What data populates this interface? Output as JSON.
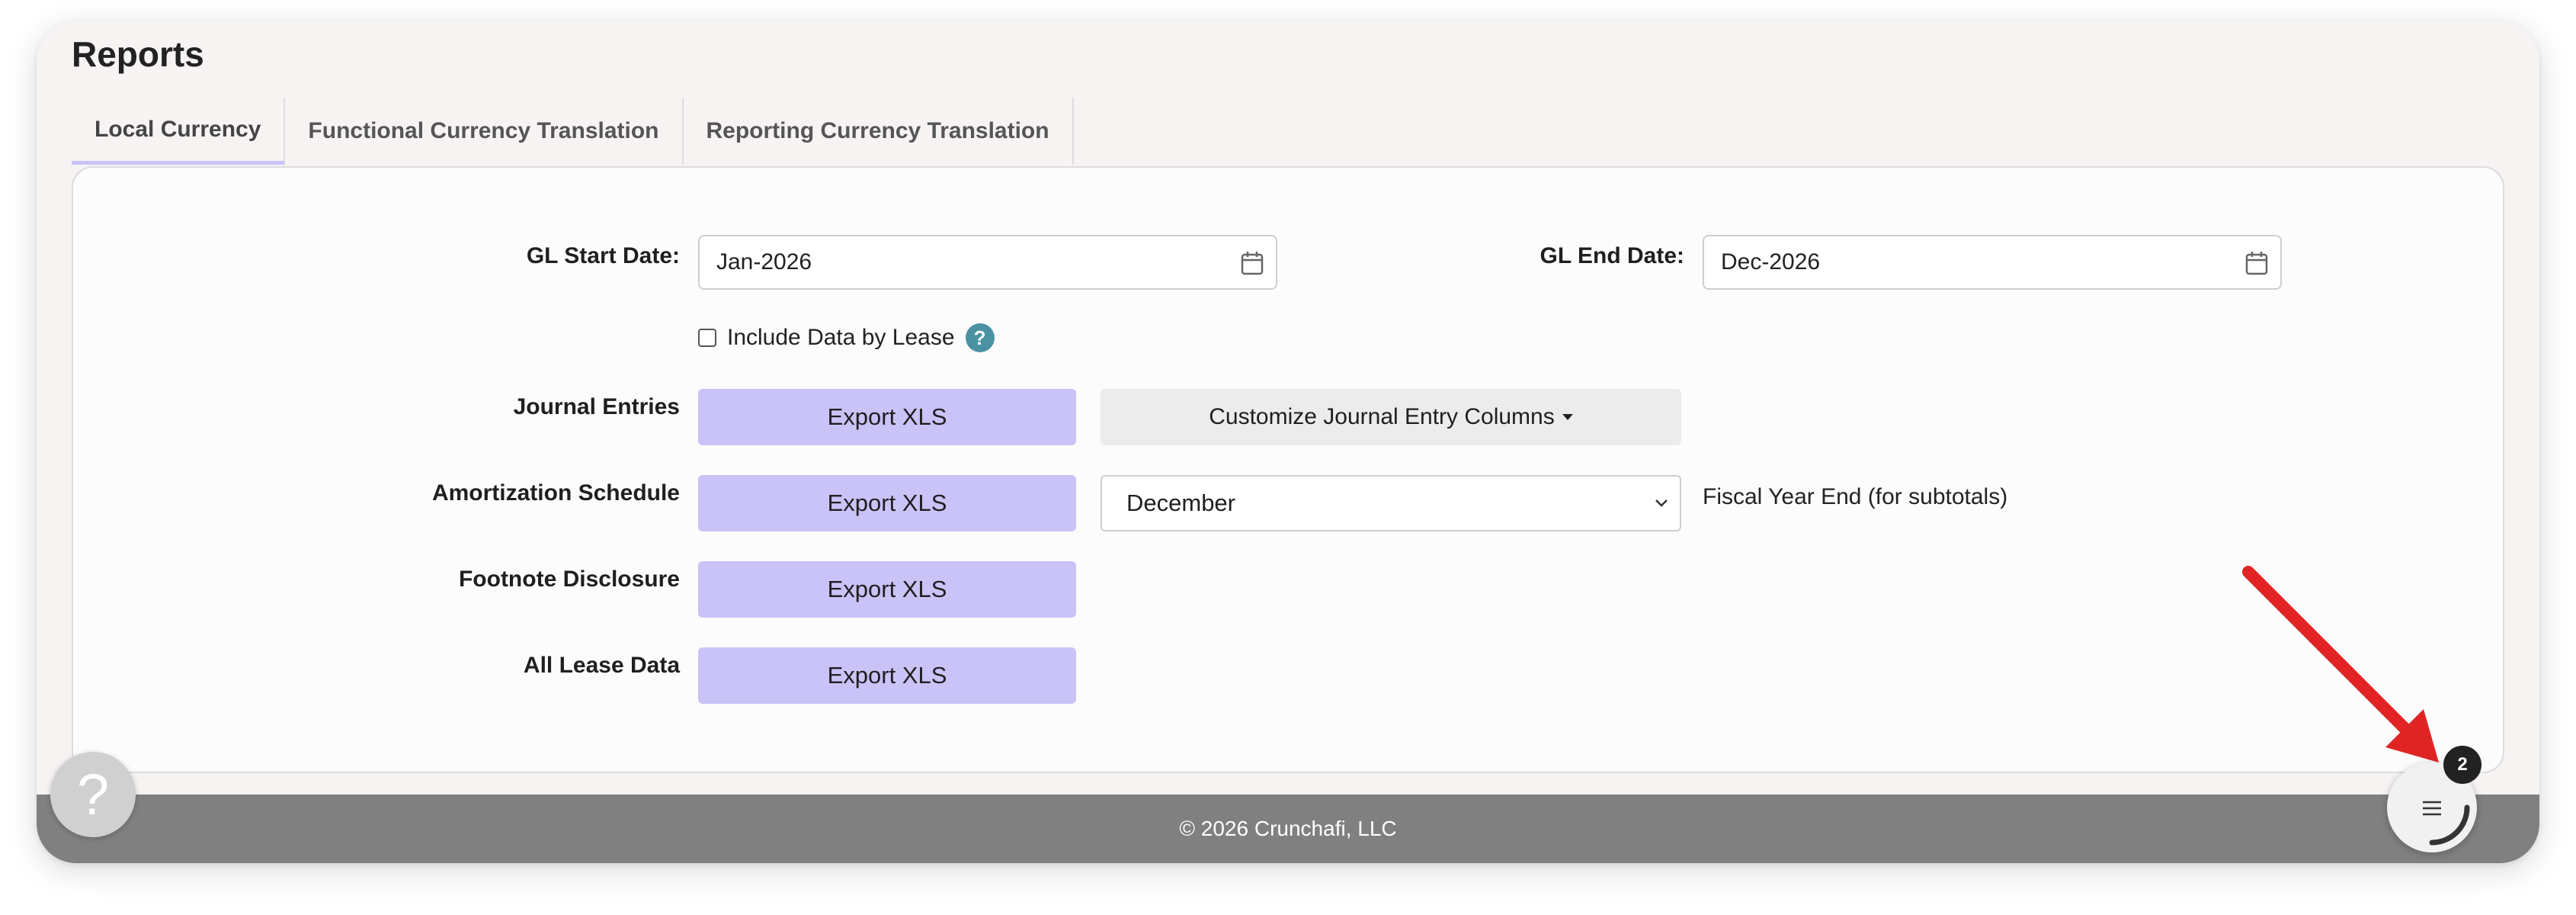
{
  "page": {
    "title": "Reports"
  },
  "tabs": [
    {
      "label": "Local Currency",
      "active": true
    },
    {
      "label": "Functional Currency Translation",
      "active": false
    },
    {
      "label": "Reporting Currency Translation",
      "active": false
    }
  ],
  "form": {
    "gl_start": {
      "label": "GL Start Date:",
      "value": "Jan-2026"
    },
    "gl_end": {
      "label": "GL End Date:",
      "value": "Dec-2026"
    },
    "include_by_lease": {
      "label": "Include Data by Lease",
      "checked": false,
      "help": "?"
    }
  },
  "reports": {
    "journal_entries": {
      "label": "Journal Entries",
      "button": "Export XLS",
      "customize": "Customize Journal Entry Columns"
    },
    "amortization": {
      "label": "Amortization Schedule",
      "button": "Export XLS",
      "select_value": "December",
      "note": "Fiscal Year End (for subtotals)"
    },
    "footnote": {
      "label": "Footnote Disclosure",
      "button": "Export XLS"
    },
    "all_lease": {
      "label": "All Lease Data",
      "button": "Export XLS"
    }
  },
  "footer": {
    "text": "©  2026 Crunchafi, LLC"
  },
  "help_fab": {
    "glyph": "?"
  },
  "menu_fab": {
    "badge": "2"
  },
  "colors": {
    "accent": "#c9c3f8",
    "footer": "#808080",
    "help_badge": "#4b92a3",
    "annotation_arrow": "#e02424"
  }
}
